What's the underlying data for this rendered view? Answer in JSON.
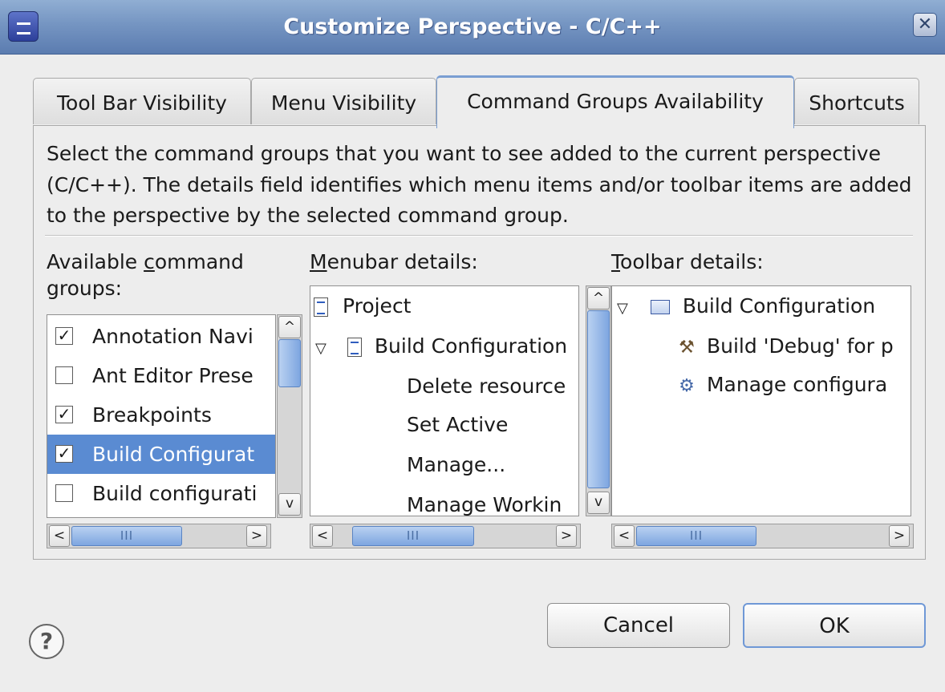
{
  "window": {
    "title": "Customize Perspective - C/C++",
    "close_label": "✕"
  },
  "tabs": [
    {
      "label": "Tool Bar Visibility",
      "active": false
    },
    {
      "label": "Menu Visibility",
      "active": false
    },
    {
      "label": "Command Groups Availability",
      "active": true
    },
    {
      "label": "Shortcuts",
      "active": false
    }
  ],
  "description": "Select the command groups that you want to see added to the current perspective (C/C++).  The details field identifies which menu items and/or toolbar items are added to the perspective by the selected command group.",
  "command_groups": {
    "label_line1_pre": "Available ",
    "label_line1_accel": "c",
    "label_line1_post": "ommand",
    "label_line2": "groups:",
    "items": [
      {
        "label": "Annotation Navi",
        "checked": true,
        "selected": false
      },
      {
        "label": "Ant Editor Prese",
        "checked": false,
        "selected": false
      },
      {
        "label": "Breakpoints",
        "checked": true,
        "selected": false
      },
      {
        "label": "Build Configurat",
        "checked": true,
        "selected": true
      },
      {
        "label": "Build configurati",
        "checked": false,
        "selected": false
      }
    ]
  },
  "menubar": {
    "label_accel": "M",
    "label_rest": "enubar details:",
    "items": [
      {
        "label": "Project"
      },
      {
        "label": "Build Configuration"
      },
      {
        "label": "Delete resource"
      },
      {
        "label": "Set Active"
      },
      {
        "label": "Manage..."
      },
      {
        "label": "Manage Workin"
      }
    ]
  },
  "toolbar": {
    "label_accel": "T",
    "label_rest": "oolbar details:",
    "items": [
      {
        "label": "Build Configuration"
      },
      {
        "label": "Build 'Debug' for p"
      },
      {
        "label": "Manage configura"
      }
    ]
  },
  "scrollbar": {
    "grip": "III",
    "left": "<",
    "right": ">",
    "up": "^",
    "down": "v"
  },
  "buttons": {
    "cancel": "Cancel",
    "ok": "OK",
    "help": "?"
  },
  "colors": {
    "title_bar": "#7595c2",
    "selection": "#5a8bd2",
    "accent": "#7a9ed2"
  }
}
